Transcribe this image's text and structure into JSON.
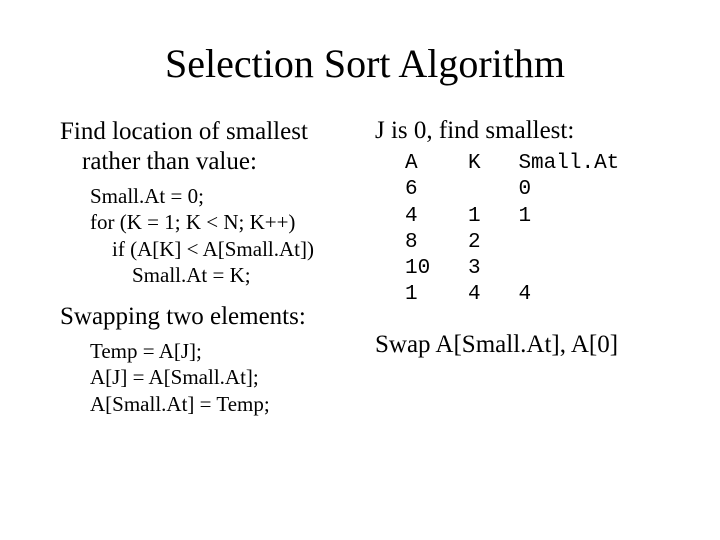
{
  "title": "Selection Sort Algorithm",
  "left": {
    "heading1_l1": "Find location of smallest",
    "heading1_l2": "rather than value:",
    "code1": {
      "line1": "Small.At = 0;",
      "line2": "for (K = 1; K < N; K++)",
      "line3": "if (A[K] < A[Small.At])",
      "line4": "Small.At = K;"
    },
    "heading2": "Swapping two elements:",
    "code2": {
      "line1": "Temp = A[J];",
      "line2": "A[J] = A[Small.At];",
      "line3": "A[Small.At] = Temp;"
    }
  },
  "right": {
    "heading": "J is 0, find smallest:",
    "trace_header": {
      "A": "A",
      "K": "K",
      "S": "Small.At"
    },
    "trace_rows": [
      {
        "A": "6",
        "K": "",
        "S": "0"
      },
      {
        "A": "4",
        "K": "1",
        "S": "1"
      },
      {
        "A": "8",
        "K": "2",
        "S": ""
      },
      {
        "A": "10",
        "K": "3",
        "S": ""
      },
      {
        "A": "1",
        "K": "4",
        "S": "4"
      }
    ],
    "swap": "Swap A[Small.At], A[0]"
  },
  "chart_data": {
    "type": "table",
    "title": "Selection sort trace for J=0",
    "columns": [
      "A",
      "K",
      "Small.At"
    ],
    "rows": [
      [
        "6",
        "",
        "0"
      ],
      [
        "4",
        "1",
        "1"
      ],
      [
        "8",
        "2",
        ""
      ],
      [
        "10",
        "3",
        ""
      ],
      [
        "1",
        "4",
        "4"
      ]
    ]
  }
}
